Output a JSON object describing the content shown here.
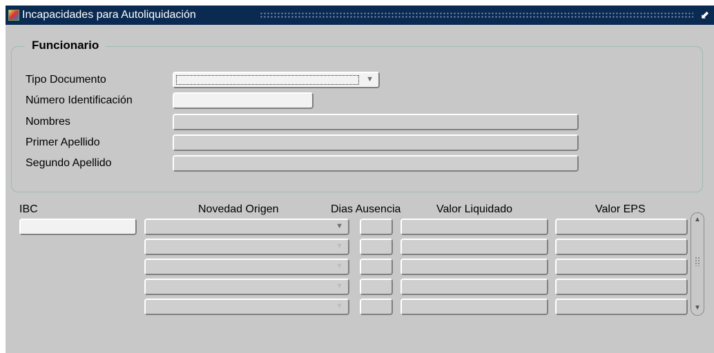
{
  "window": {
    "title": "Incapacidades para Autoliquidación",
    "minimize_glyph": "⬋"
  },
  "frame": {
    "title": "Funcionario"
  },
  "funcionario": {
    "tipo_documento": {
      "label": "Tipo Documento",
      "value": ""
    },
    "numero_identificacion": {
      "label": "Número Identificación",
      "value": ""
    },
    "nombres": {
      "label": "Nombres",
      "value": ""
    },
    "primer_apellido": {
      "label": "Primer Apellido",
      "value": ""
    },
    "segundo_apellido": {
      "label": "Segundo Apellido",
      "value": ""
    }
  },
  "detalle": {
    "headers": {
      "ibc": "IBC",
      "novedad_origen": "Novedad Origen",
      "dias_ausencia": "Dias Ausencia",
      "valor_liquidado": "Valor Liquidado",
      "valor_eps": "Valor EPS"
    },
    "ibc_value": "",
    "rows": [
      {
        "novedad_origen": "",
        "dias_ausencia": "",
        "valor_liquidado": "",
        "valor_eps": ""
      },
      {
        "novedad_origen": "",
        "dias_ausencia": "",
        "valor_liquidado": "",
        "valor_eps": ""
      },
      {
        "novedad_origen": "",
        "dias_ausencia": "",
        "valor_liquidado": "",
        "valor_eps": ""
      },
      {
        "novedad_origen": "",
        "dias_ausencia": "",
        "valor_liquidado": "",
        "valor_eps": ""
      },
      {
        "novedad_origen": "",
        "dias_ausencia": "",
        "valor_liquidado": "",
        "valor_eps": ""
      }
    ]
  },
  "icons": {
    "app": "oracle-forms-app-icon",
    "minimize": "minimize-icon",
    "combo": "chevron-down-icon",
    "scroll_up": "scroll-up-icon",
    "scroll_down": "scroll-down-icon"
  }
}
